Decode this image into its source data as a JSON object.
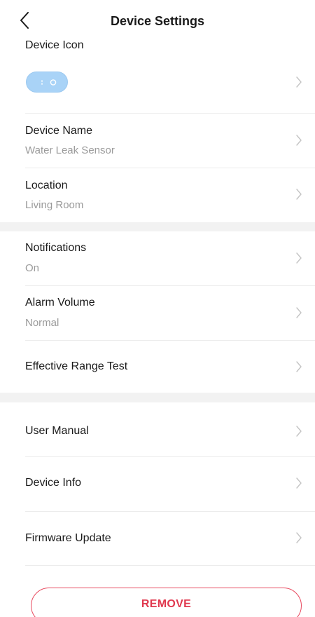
{
  "header": {
    "title": "Device Settings",
    "back_icon": "chevron-left-icon"
  },
  "device_icon": {
    "label": "Device Icon",
    "icon": "water-leak-sensor-icon",
    "pill_color": "#a9d3f7"
  },
  "device_name": {
    "label": "Device Name",
    "value": "Water Leak Sensor"
  },
  "location": {
    "label": "Location",
    "value": "Living Room"
  },
  "notifications": {
    "label": "Notifications",
    "value": "On"
  },
  "alarm_volume": {
    "label": "Alarm Volume",
    "value": "Normal"
  },
  "range_test": {
    "label": "Effective Range Test"
  },
  "user_manual": {
    "label": "User Manual"
  },
  "device_info": {
    "label": "Device Info"
  },
  "firmware_update": {
    "label": "Firmware Update"
  },
  "remove": {
    "label": "REMOVE",
    "color": "#e0394f"
  },
  "colors": {
    "section_gap": "#f2f2f2",
    "divider": "#ececec",
    "subtext": "#9a9a9a",
    "chevron": "#c4c4c4"
  }
}
